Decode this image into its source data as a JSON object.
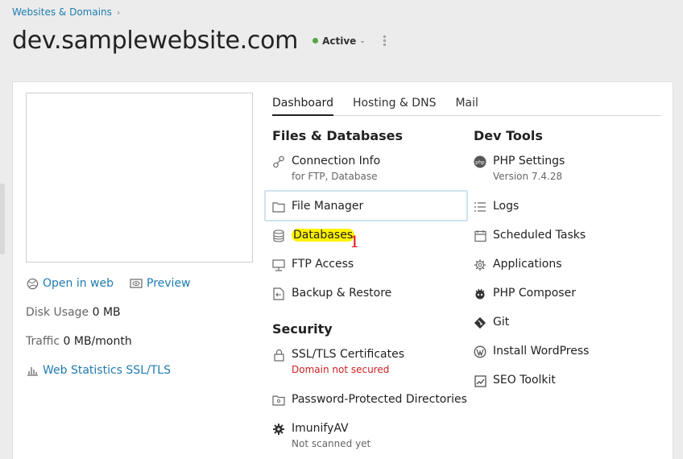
{
  "breadcrumb": {
    "label": "Websites & Domains"
  },
  "header": {
    "title": "dev.samplewebsite.com",
    "status_label": "Active"
  },
  "left": {
    "open_in_web": "Open in web",
    "preview": "Preview",
    "disk_usage_label": "Disk Usage",
    "disk_usage_value": "0 MB",
    "traffic_label": "Traffic",
    "traffic_value": "0 MB/month",
    "web_statistics": "Web Statistics SSL/TLS"
  },
  "tabs": [
    {
      "label": "Dashboard",
      "active": true
    },
    {
      "label": "Hosting & DNS",
      "active": false
    },
    {
      "label": "Mail",
      "active": false
    }
  ],
  "files_databases": {
    "title": "Files & Databases",
    "connection_info": {
      "label": "Connection Info",
      "sub": "for FTP, Database"
    },
    "file_manager": "File Manager",
    "databases": "Databases",
    "ftp_access": "FTP Access",
    "backup_restore": "Backup & Restore"
  },
  "security": {
    "title": "Security",
    "ssl": {
      "label": "SSL/TLS Certificates",
      "sub": "Domain not secured"
    },
    "password_dirs": "Password-Protected Directories",
    "imunify": {
      "label": "ImunifyAV",
      "sub": "Not scanned yet"
    }
  },
  "dev_tools": {
    "title": "Dev Tools",
    "php_settings": {
      "label": "PHP Settings",
      "sub": "Version 7.4.28"
    },
    "logs": "Logs",
    "scheduled_tasks": "Scheduled Tasks",
    "applications": "Applications",
    "php_composer": "PHP Composer",
    "git": "Git",
    "install_wordpress": "Install WordPress",
    "seo_toolkit": "SEO Toolkit"
  },
  "annotation": {
    "mark": "1"
  },
  "colors": {
    "link": "#1f7bb0",
    "active_dot": "#52a744",
    "error": "#d02020",
    "highlight": "#fff200"
  }
}
